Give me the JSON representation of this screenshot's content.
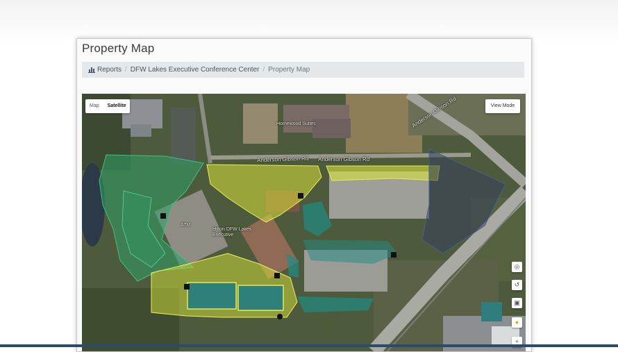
{
  "page": {
    "title": "Property Map"
  },
  "breadcrumb": {
    "items": [
      "Reports",
      "DFW Lakes Executive Conference Center",
      "Property Map"
    ]
  },
  "map": {
    "type_toggle": {
      "map": "Map",
      "satellite": "Satellite",
      "selected": "Satellite"
    },
    "view_mode_button": "View Mode",
    "street_labels": [
      "Anderson Gibson Rd",
      "Anderson Gibson Rd",
      "Anderson Gibson Rd"
    ],
    "place_labels": [
      "Hilton DFW Lakes Executive",
      "Homewood Suites",
      "ATM"
    ],
    "controls": [
      "locate-icon",
      "tilt-icon",
      "street-view-icon",
      "pegman-icon",
      "zoom-in-icon"
    ],
    "zone_colors": {
      "green": "#2fa06a",
      "yellow": "#d8e23a",
      "teal": "#1f8c86",
      "marker": "#111111"
    }
  }
}
